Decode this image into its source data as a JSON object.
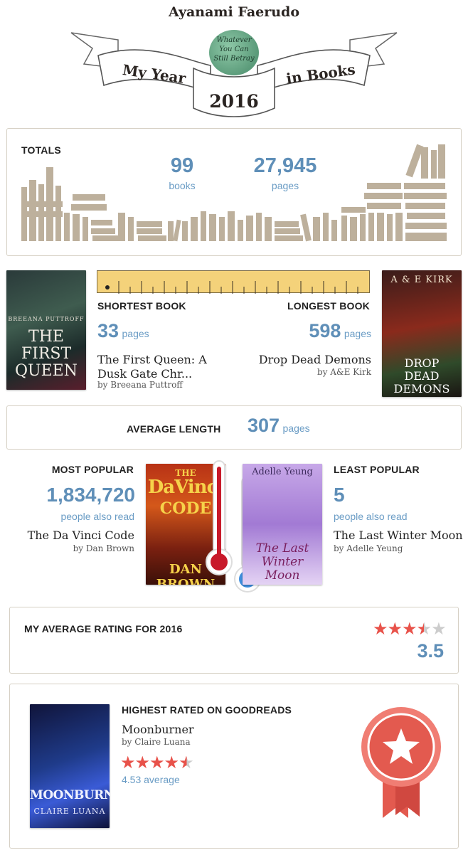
{
  "header": {
    "user_name": "Ayanami Faerudo",
    "avatar_text": "Whatever You Can Still Betray",
    "banner_left": "My Year",
    "banner_right": "in Books",
    "year": "2016"
  },
  "totals": {
    "label": "TOTALS",
    "books_value": "99",
    "books_unit": "books",
    "pages_value": "27,945",
    "pages_unit": "pages"
  },
  "length": {
    "shortest_label": "SHORTEST BOOK",
    "longest_label": "LONGEST BOOK",
    "shortest": {
      "pages": "33",
      "unit": "pages",
      "title": "The First Queen: A Dusk Gate Chr...",
      "author": "by Breeana Puttroff",
      "cover_author": "BREEANA PUTTROFF",
      "cover_title": "THE FIRST QUEEN"
    },
    "longest": {
      "pages": "598",
      "unit": "pages",
      "title": "Drop Dead Demons",
      "author": "by A&E Kirk",
      "cover_author": "A & E KIRK",
      "cover_title": "DROP DEAD DEMONS"
    }
  },
  "average": {
    "label": "AVERAGE LENGTH",
    "value": "307",
    "unit": "pages"
  },
  "popularity": {
    "most_label": "MOST POPULAR",
    "least_label": "LEAST POPULAR",
    "most": {
      "count": "1,834,720",
      "caption": "people also read",
      "title": "The Da Vinci Code",
      "author": "by Dan Brown",
      "cover_title_1": "THE",
      "cover_title_2": "DaVinci",
      "cover_title_3": "CODE",
      "cover_author": "DAN BROWN"
    },
    "least": {
      "count": "5",
      "caption": "people also read",
      "title": "The Last Winter Moon",
      "author": "by Adelle Yeung",
      "cover_author": "Adelle Yeung",
      "cover_title": "The Last Winter Moon"
    }
  },
  "rating": {
    "label": "MY AVERAGE RATING FOR 2016",
    "value": "3.5",
    "stars": 3.5
  },
  "highest": {
    "label": "HIGHEST RATED ON GOODREADS",
    "title": "Moonburner",
    "author": "by Claire Luana",
    "average": "4.53 average",
    "stars": 4.5,
    "cover_title": "MOONBURNER",
    "cover_author": "CLAIRE LUANA"
  },
  "colors": {
    "accent_blue": "#5f8fb8",
    "book_tan": "#bdb09c",
    "star_red": "#e8524a",
    "ribbon_red": "#e35a4f"
  }
}
